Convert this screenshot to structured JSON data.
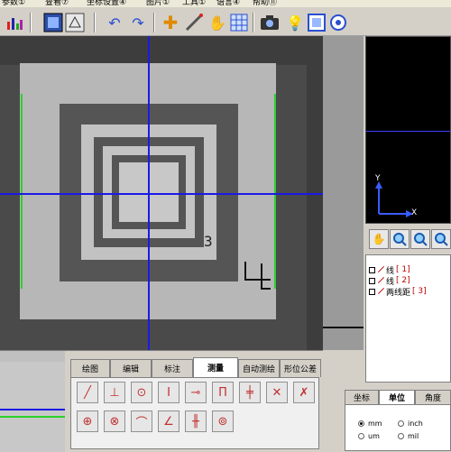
{
  "menu": [
    "参数①",
    "查看⑦",
    "坐标设置④",
    "图片①",
    "工具①",
    "语言④",
    "帮助⑪"
  ],
  "toolbar": {
    "icons": [
      "chart-icon",
      "open-image-icon",
      "settings-icon",
      "undo-icon",
      "redo-icon",
      "crosshair-icon",
      "measure-tool-icon",
      "hand-icon",
      "grid-icon",
      "camera-icon",
      "light-icon",
      "view-icon",
      "target-icon"
    ]
  },
  "minimap": {
    "y_label": "Y",
    "x_label": "X"
  },
  "list": {
    "items": [
      {
        "label": "线",
        "index": "[ 1]"
      },
      {
        "label": "线",
        "index": "[ 2]"
      },
      {
        "label": "两线距",
        "index": "[ 3]"
      }
    ]
  },
  "image": {
    "digit": "4",
    "small_digit": "3"
  },
  "tabs": [
    "绘图",
    "编辑",
    "标注",
    "测量",
    "自动测绘",
    "形位公差"
  ],
  "active_tab": "测量",
  "unit_tabs": [
    "坐标",
    "单位",
    "角度"
  ],
  "active_unit_tab": "单位",
  "units": [
    {
      "label": "mm",
      "selected": true
    },
    {
      "label": "inch",
      "selected": false
    },
    {
      "label": "um",
      "selected": false
    },
    {
      "label": "mil",
      "selected": false
    }
  ],
  "colors": {
    "crosshair": "#1a1ae6",
    "edge_line": "#2bd12b",
    "accent": "#c00000"
  }
}
